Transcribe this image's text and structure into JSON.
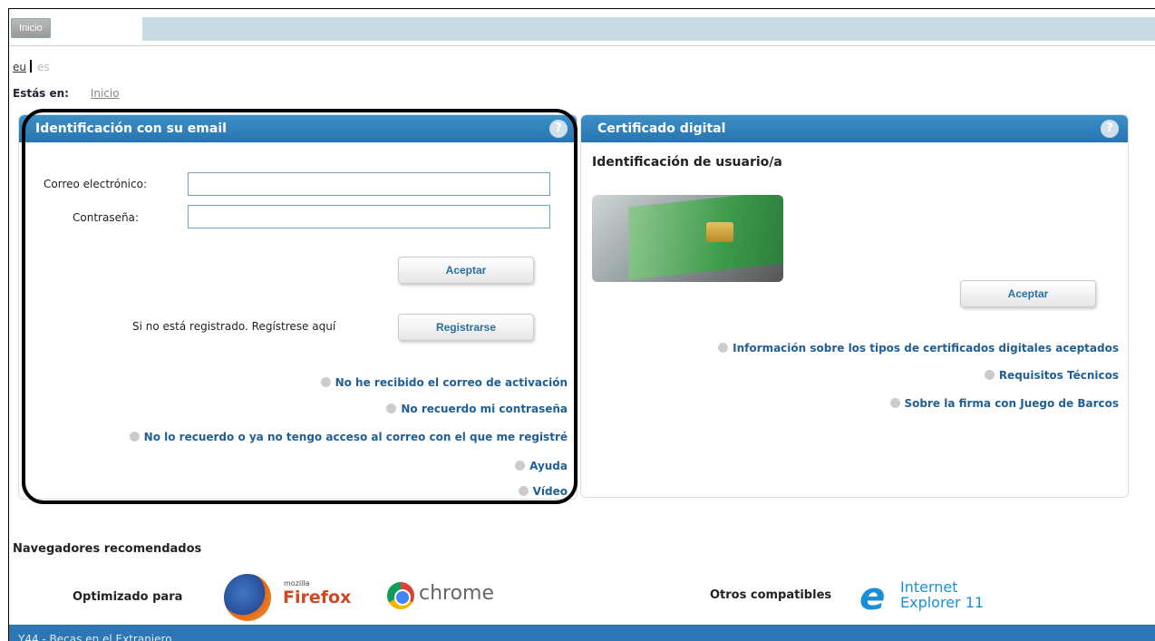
{
  "header": {
    "home_button": "Inicio"
  },
  "languages": {
    "active": "eu",
    "inactive": "es"
  },
  "breadcrumb": {
    "label": "Estás en:",
    "current": "Inicio"
  },
  "email_panel": {
    "title": "Identificación con su email",
    "help_icon": "?",
    "email_label": "Correo electrónico:",
    "email_value": "",
    "password_label": "Contraseña:",
    "password_value": "",
    "accept_label": "Aceptar",
    "register_prompt": "Si no está registrado. Regístrese aquí",
    "register_label": "Registrarse",
    "links": [
      "No he recibido el correo de activación",
      "No recuerdo mi contraseña",
      "No lo recuerdo o ya no tengo acceso al correo con el que me registré",
      "Ayuda",
      "Vídeo"
    ]
  },
  "cert_panel": {
    "title": "Certificado digital",
    "help_icon": "?",
    "subtitle": "Identificación de usuario/a",
    "accept_label": "Aceptar",
    "links": [
      "Información sobre los tipos de certificados digitales aceptados",
      "Requisitos Técnicos",
      "Sobre la firma con Juego de Barcos"
    ]
  },
  "browsers": {
    "title": "Navegadores recomendados",
    "optimized_label": "Optimizado para",
    "firefox_small": "mozilla",
    "firefox": "Firefox",
    "chrome": "chrome",
    "others_label": "Otros compatibles",
    "ie_line1": "Internet",
    "ie_line2": "Explorer 11"
  },
  "footer": {
    "text": "Y44 - Becas en el Extranjero"
  },
  "colors": {
    "panel_header": "#2775b2",
    "link": "#1f5f95",
    "footer_bar": "#2c77b3"
  }
}
